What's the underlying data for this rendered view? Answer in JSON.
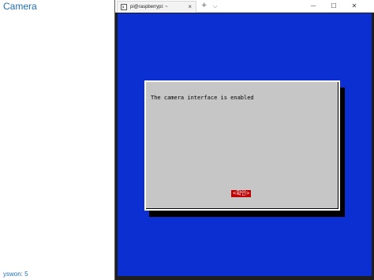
{
  "left_pane": {
    "title": "Camera",
    "footer": "yswon: 5"
  },
  "terminal": {
    "tab_title": "pi@raspberrypi: ~",
    "tab_close": "×",
    "new_tab": "+",
    "tab_dropdown": "⌵",
    "window_buttons": {
      "minimize": "—",
      "maximize": "☐",
      "close": "✕"
    },
    "background_color": "#0c2fd1"
  },
  "dialog": {
    "message": "The camera interface is enabled",
    "ok_button": "<확인>"
  }
}
